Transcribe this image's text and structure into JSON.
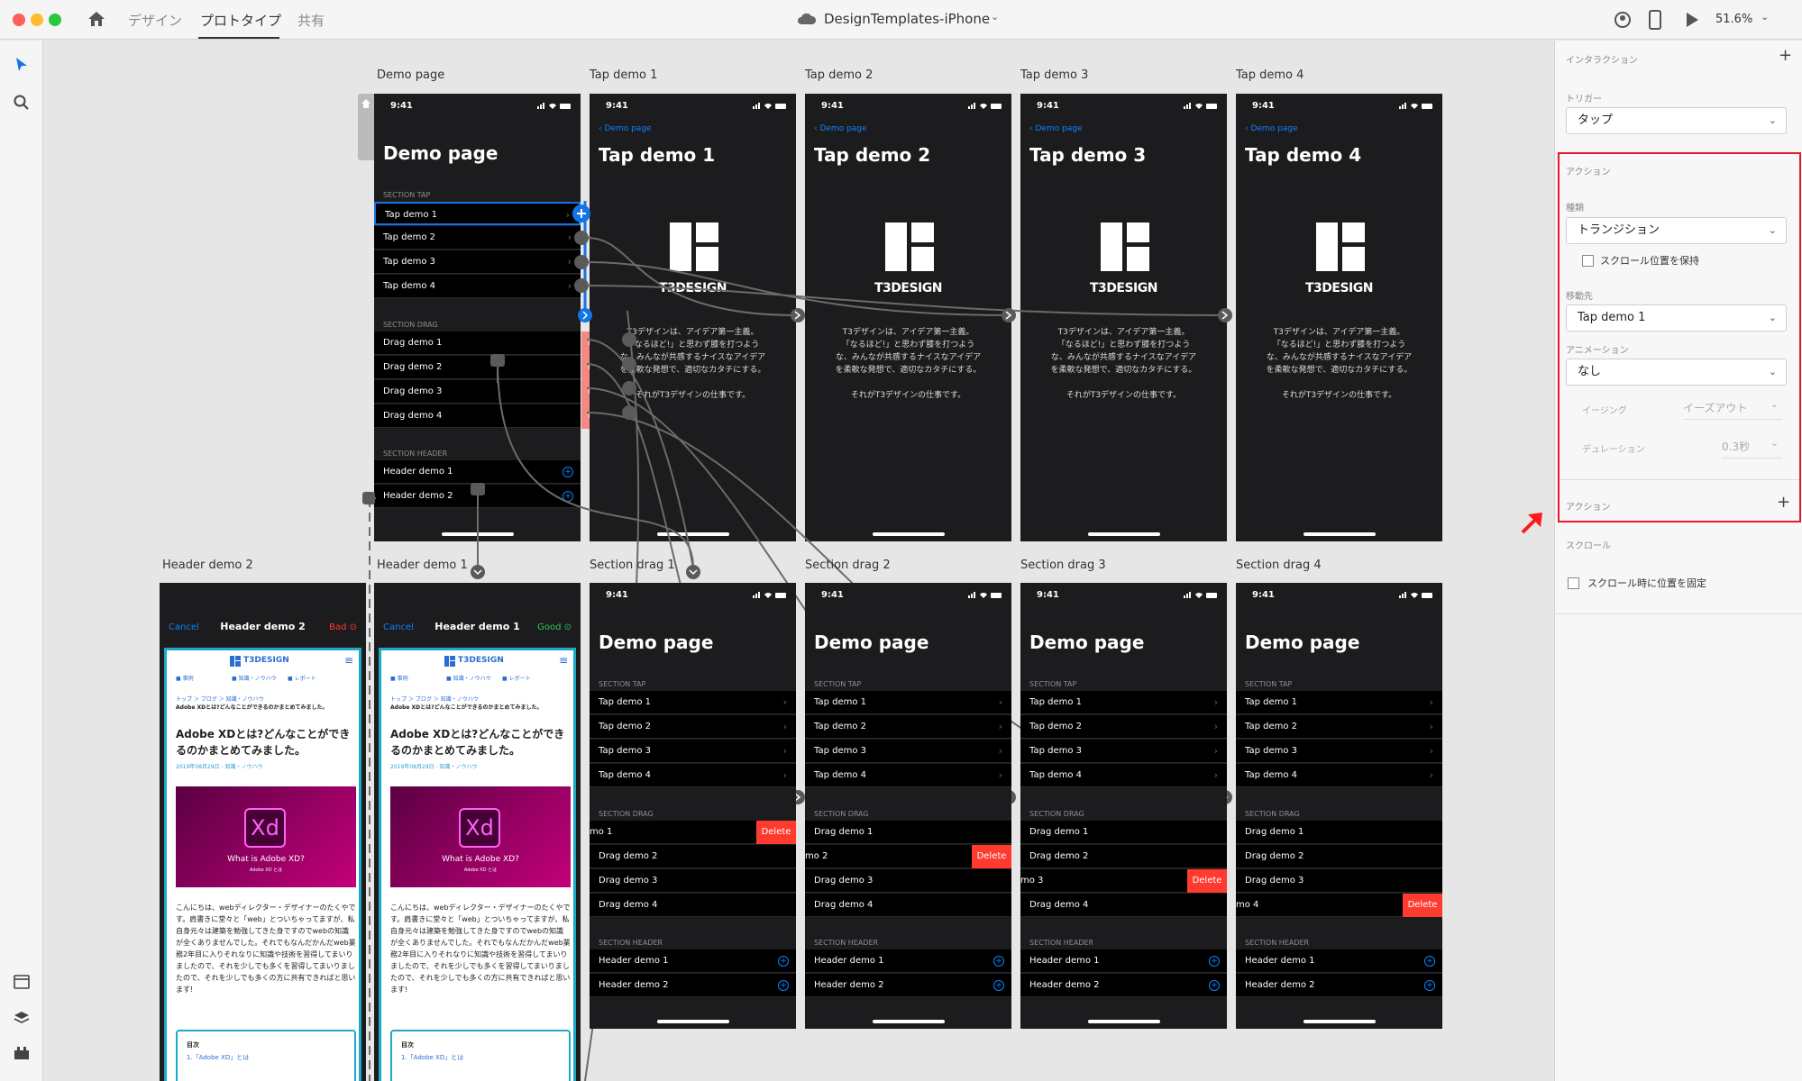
{
  "window": {
    "tabs": [
      "デザイン",
      "プロトタイプ",
      "共有"
    ],
    "active_tab": "プロトタイプ",
    "title": "DesignTemplates-iPhone",
    "zoom": "51.6%"
  },
  "artboards": {
    "demo": {
      "label": "Demo page",
      "time": "9:41",
      "title": "Demo page",
      "section_tap": "SECTION TAP",
      "tap_rows": [
        "Tap demo 1",
        "Tap demo 2",
        "Tap demo 3",
        "Tap demo 4"
      ],
      "section_drag": "SECTION DRAG",
      "drag_rows": [
        "Drag demo 1",
        "Drag demo 2",
        "Drag demo 3",
        "Drag demo 4"
      ],
      "delete": "Delete",
      "section_header": "SECTION HEADER",
      "header_rows": [
        "Header demo 1",
        "Header demo 2"
      ]
    },
    "taps": [
      {
        "label": "Tap demo 1",
        "title": "Tap demo 1"
      },
      {
        "label": "Tap demo 2",
        "title": "Tap demo 2"
      },
      {
        "label": "Tap demo 3",
        "title": "Tap demo 3"
      },
      {
        "label": "Tap demo 4",
        "title": "Tap demo 4"
      }
    ],
    "back": "Demo page",
    "brand": "T3DESIGN",
    "body": [
      "T3デザインは、アイデア第一主義。",
      "「なるほど!」と思わず膝を打つよう",
      "な、みんなが共感するナイスなアイデア",
      "を柔軟な発想で、適切なカタチにする。",
      "",
      "それがT3デザインの仕事です。"
    ],
    "drags": [
      {
        "label": "Section drag 1",
        "swiped": "mo 1"
      },
      {
        "label": "Section drag 2",
        "swiped": "mo 2"
      },
      {
        "label": "Section drag 3",
        "swiped": "mo 3"
      },
      {
        "label": "Section drag 4",
        "swiped": "mo 4"
      }
    ],
    "headers": [
      {
        "label": "Header demo 2",
        "cancel": "Cancel",
        "title": "Header demo 2",
        "status": "Bad",
        "status_color": "#ff3b30"
      },
      {
        "label": "Header demo 1",
        "cancel": "Cancel",
        "title": "Header demo 1",
        "status": "Good",
        "status_color": "#34c759"
      }
    ],
    "web": {
      "logo": "T3DESIGN",
      "nav": [
        "事例",
        "知識・ノウハウ",
        "レポート"
      ],
      "crumb": "トップ ＞ ブログ ＞ 知識・ノウハウ",
      "sub": "Adobe XDとは?どんなことができるのかまとめてみました。",
      "headline": "Adobe XDとは?どんなことができるのかまとめてみました。",
      "date": "2019年08月29日 - 知識・ノウハウ",
      "xd": "Xd",
      "xd_caption": "What is Adobe XD?",
      "xd_small": "Adobe XD とは",
      "paragraph": "こんにちは、webディレクター・デザイナーのたくやです。肩書きに堂々と「web」とついちゃってますが、私自身元々は建築を勉強してきた身ですのでwebの知識が全くありませんでした。それでもなんだかんだweb業務2年目に入りそれなりに知識や技術を習得してまいりましたので、それを少しでも多くを習得してまいりましたので、それを少しでも多くの方に共有できればと思います!",
      "toc": "目次",
      "toc_item": "1.「Adobe XD」とは"
    }
  },
  "panel": {
    "interaction": "インタラクション",
    "trigger_label": "トリガー",
    "trigger": "タップ",
    "action_label": "アクション",
    "type_label": "種類",
    "type": "トランジション",
    "keep_scroll": "スクロール位置を保持",
    "dest_label": "移動先",
    "dest": "Tap demo 1",
    "anim_label": "アニメーション",
    "anim": "なし",
    "easing_label": "イージング",
    "easing": "イーズアウト",
    "duration_label": "デュレーション",
    "duration": "0.3秒",
    "action2_label": "アクション",
    "scroll_label": "スクロール",
    "fix_scroll": "スクロール時に位置を固定"
  }
}
